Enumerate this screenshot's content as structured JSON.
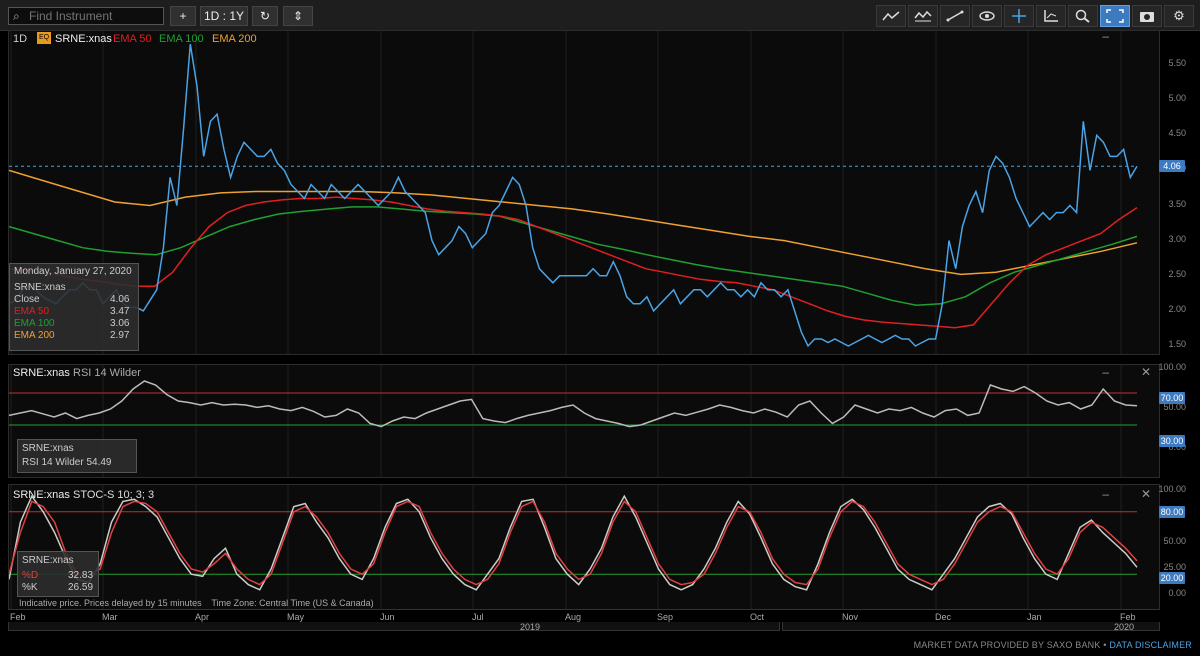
{
  "toolbar": {
    "search_placeholder": "Find Instrument",
    "add_label": "+",
    "period_label": "1D : 1Y",
    "refresh_label": "↻",
    "compare_label": "⇕",
    "settings_label": "⚙"
  },
  "main_chart": {
    "interval": "1D",
    "eq_badge": "EQ",
    "symbol": "SRNE:xnas",
    "ema50_label": "EMA 50",
    "ema100_label": "EMA 100",
    "ema200_label": "EMA 200",
    "y_ticks": [
      "5.50",
      "5.00",
      "4.50",
      "4.00",
      "3.50",
      "3.00",
      "2.50",
      "2.00",
      "1.50"
    ],
    "last_price_badge": "4.06",
    "tooltip": {
      "date": "Monday, January 27, 2020",
      "symbol": "SRNE:xnas",
      "close_label": "Close",
      "close_value": "4.06",
      "ema50_label": "EMA 50",
      "ema50_value": "3.47",
      "ema100_label": "EMA 100",
      "ema100_value": "3.06",
      "ema200_label": "EMA 200",
      "ema200_value": "2.97"
    }
  },
  "rsi_chart": {
    "symbol": "SRNE:xnas",
    "title": "RSI 14 Wilder",
    "y_ticks": [
      "100.00",
      "50.00",
      "0.00"
    ],
    "upper_badge": "70.00",
    "lower_badge": "30.00",
    "tooltip": {
      "symbol": "SRNE:xnas",
      "value_text": "RSI 14 Wilder 54.49"
    }
  },
  "stoc_chart": {
    "symbol": "SRNE:xnas",
    "title": "STOC-S 10; 3; 3",
    "y_ticks": [
      "100.00",
      "50.00",
      "25.00",
      "0.00"
    ],
    "upper_badge": "80.00",
    "lower_badge": "20.00",
    "tooltip": {
      "symbol": "SRNE:xnas",
      "d_label": "%D",
      "d_value": "32.83",
      "k_label": "%K",
      "k_value": "26.59"
    },
    "notice": "Indicative price. Prices delayed by 15 minutes    Time Zone: Central Time (US & Canada)"
  },
  "x_axis": {
    "months": [
      "Feb",
      "Mar",
      "Apr",
      "May",
      "Jun",
      "Jul",
      "Aug",
      "Sep",
      "Oct",
      "Nov",
      "Dec",
      "Jan",
      "Feb"
    ],
    "year_2019": "2019",
    "year_2020": "2020"
  },
  "footer": {
    "provider_text": "MARKET DATA PROVIDED BY SAXO BANK •",
    "disclaimer_link": "DATA DISCLAIMER"
  },
  "colors": {
    "price": "#4aa3e6",
    "ema50": "#e02020",
    "ema100": "#20a030",
    "ema200": "#f0a030",
    "rsi": "#bbbbbb",
    "stoc_d": "#e04040",
    "stoc_k": "#cccccc",
    "badge_blue": "#3d7ac0"
  },
  "chart_data": {
    "type": "line",
    "x_range": [
      "2019-02",
      "2020-02"
    ],
    "price": [
      2.1,
      2.15,
      2.3,
      2.35,
      2.3,
      2.2,
      2.15,
      2.1,
      2.2,
      2.3,
      2.3,
      2.4,
      2.3,
      2.3,
      2.1,
      2.2,
      2.3,
      2.1,
      2.05,
      2.05,
      2.0,
      2.15,
      2.3,
      2.9,
      3.9,
      3.5,
      4.6,
      5.8,
      5.2,
      4.2,
      4.7,
      4.8,
      4.3,
      3.9,
      4.2,
      4.4,
      4.3,
      4.2,
      4.2,
      4.3,
      4.1,
      4.0,
      3.8,
      3.7,
      3.6,
      3.8,
      3.7,
      3.6,
      3.8,
      3.7,
      3.6,
      3.7,
      3.8,
      3.7,
      3.6,
      3.5,
      3.6,
      3.7,
      3.9,
      3.7,
      3.6,
      3.5,
      3.4,
      3.0,
      2.8,
      2.9,
      3.0,
      3.2,
      3.1,
      2.9,
      3.0,
      3.1,
      3.4,
      3.5,
      3.7,
      3.9,
      3.8,
      3.5,
      2.9,
      2.6,
      2.5,
      2.4,
      2.5,
      2.5,
      2.5,
      2.5,
      2.5,
      2.6,
      2.5,
      2.5,
      2.7,
      2.5,
      2.2,
      2.1,
      2.1,
      2.2,
      2.0,
      2.1,
      2.2,
      2.3,
      2.1,
      2.2,
      2.3,
      2.3,
      2.2,
      2.3,
      2.4,
      2.3,
      2.3,
      2.2,
      2.3,
      2.2,
      2.4,
      2.3,
      2.3,
      2.2,
      2.3,
      2.0,
      1.7,
      1.5,
      1.6,
      1.6,
      1.55,
      1.6,
      1.55,
      1.5,
      1.55,
      1.6,
      1.65,
      1.6,
      1.55,
      1.6,
      1.65,
      1.6,
      1.6,
      1.5,
      1.55,
      1.6,
      1.6,
      2.1,
      3.0,
      2.6,
      3.2,
      3.5,
      3.7,
      3.4,
      4.0,
      4.2,
      4.1,
      3.9,
      3.6,
      3.4,
      3.2,
      3.3,
      3.4,
      3.3,
      3.4,
      3.4,
      3.5,
      3.4,
      4.7,
      4.0,
      4.5,
      4.4,
      4.2,
      4.2,
      4.3,
      3.9,
      4.06
    ],
    "ema50": [
      2.6,
      2.58,
      2.55,
      2.5,
      2.45,
      2.42,
      2.38,
      2.35,
      2.35,
      2.55,
      2.9,
      3.2,
      3.4,
      3.5,
      3.55,
      3.58,
      3.6,
      3.6,
      3.62,
      3.6,
      3.58,
      3.55,
      3.5,
      3.45,
      3.42,
      3.4,
      3.38,
      3.35,
      3.3,
      3.2,
      3.1,
      3.0,
      2.9,
      2.8,
      2.7,
      2.6,
      2.55,
      2.5,
      2.45,
      2.42,
      2.4,
      2.35,
      2.3,
      2.2,
      2.1,
      2.0,
      1.92,
      1.87,
      1.84,
      1.82,
      1.8,
      1.78,
      1.76,
      1.8,
      2.1,
      2.4,
      2.65,
      2.8,
      2.9,
      3.0,
      3.1,
      3.3,
      3.47
    ],
    "ema100": [
      3.2,
      3.1,
      3.0,
      2.9,
      2.85,
      2.82,
      2.8,
      2.9,
      3.05,
      3.2,
      3.3,
      3.38,
      3.42,
      3.45,
      3.48,
      3.48,
      3.45,
      3.42,
      3.4,
      3.38,
      3.35,
      3.25,
      3.15,
      3.05,
      2.95,
      2.88,
      2.8,
      2.73,
      2.66,
      2.6,
      2.55,
      2.5,
      2.45,
      2.4,
      2.35,
      2.25,
      2.15,
      2.08,
      2.1,
      2.2,
      2.4,
      2.55,
      2.65,
      2.75,
      2.85,
      2.95,
      3.06
    ],
    "ema200": [
      4.0,
      3.85,
      3.7,
      3.55,
      3.5,
      3.62,
      3.68,
      3.7,
      3.7,
      3.7,
      3.7,
      3.68,
      3.65,
      3.6,
      3.55,
      3.5,
      3.45,
      3.38,
      3.3,
      3.22,
      3.14,
      3.06,
      3.0,
      2.9,
      2.8,
      2.7,
      2.6,
      2.52,
      2.55,
      2.65,
      2.75,
      2.85,
      2.97
    ],
    "price_ylim": [
      1.4,
      5.9
    ],
    "rsi_ylim": [
      0,
      100
    ],
    "stoc_ylim": [
      0,
      100
    ],
    "rsi": [
      42,
      45,
      48,
      44,
      40,
      45,
      38,
      42,
      45,
      50,
      60,
      75,
      85,
      80,
      68,
      60,
      58,
      55,
      58,
      55,
      56,
      55,
      52,
      54,
      50,
      48,
      52,
      47,
      40,
      42,
      50,
      45,
      32,
      28,
      35,
      40,
      38,
      45,
      50,
      55,
      60,
      62,
      38,
      35,
      33,
      38,
      42,
      45,
      48,
      52,
      55,
      45,
      38,
      35,
      32,
      28,
      30,
      35,
      40,
      45,
      42,
      46,
      50,
      55,
      52,
      48,
      45,
      50,
      46,
      40,
      55,
      60,
      45,
      32,
      40,
      55,
      50,
      45,
      50,
      48,
      52,
      45,
      40,
      48,
      50,
      42,
      45,
      80,
      75,
      72,
      78,
      70,
      60,
      55,
      58,
      50,
      55,
      75,
      60,
      55,
      54
    ],
    "stoc_d": [
      20,
      60,
      90,
      85,
      70,
      40,
      20,
      18,
      25,
      60,
      85,
      90,
      88,
      80,
      60,
      40,
      25,
      22,
      30,
      40,
      25,
      15,
      10,
      20,
      50,
      80,
      85,
      75,
      60,
      40,
      25,
      20,
      30,
      60,
      85,
      90,
      85,
      60,
      40,
      25,
      15,
      10,
      15,
      30,
      60,
      85,
      90,
      70,
      40,
      25,
      15,
      20,
      40,
      70,
      90,
      80,
      55,
      30,
      15,
      10,
      12,
      20,
      40,
      65,
      85,
      80,
      60,
      35,
      20,
      12,
      10,
      25,
      55,
      80,
      90,
      85,
      70,
      50,
      30,
      20,
      15,
      10,
      15,
      30,
      50,
      70,
      80,
      85,
      80,
      60,
      40,
      25,
      20,
      35,
      60,
      70,
      65,
      55,
      45,
      32.83
    ],
    "stoc_k": [
      15,
      70,
      95,
      80,
      60,
      35,
      15,
      12,
      30,
      70,
      90,
      92,
      85,
      75,
      55,
      35,
      20,
      18,
      35,
      45,
      20,
      10,
      5,
      25,
      55,
      85,
      88,
      70,
      55,
      35,
      20,
      15,
      35,
      65,
      88,
      92,
      80,
      55,
      35,
      20,
      10,
      5,
      20,
      35,
      65,
      90,
      92,
      65,
      35,
      20,
      10,
      25,
      45,
      75,
      95,
      75,
      50,
      25,
      10,
      5,
      10,
      25,
      45,
      70,
      90,
      78,
      55,
      30,
      15,
      8,
      5,
      30,
      60,
      85,
      92,
      82,
      65,
      45,
      25,
      15,
      10,
      5,
      20,
      35,
      55,
      75,
      85,
      88,
      78,
      55,
      35,
      20,
      15,
      40,
      65,
      72,
      60,
      50,
      40,
      26.59
    ]
  }
}
